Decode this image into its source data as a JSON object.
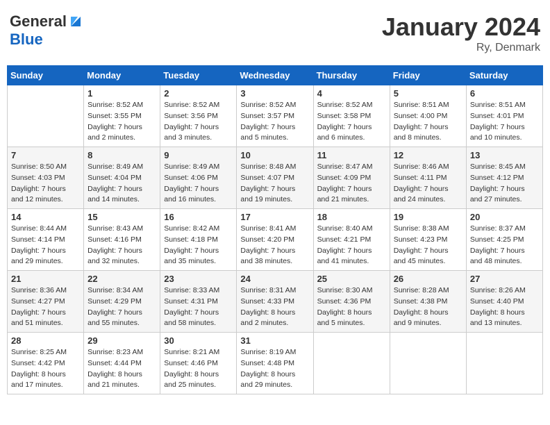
{
  "header": {
    "logo_line1": "General",
    "logo_line2": "Blue",
    "month": "January 2024",
    "location": "Ry, Denmark"
  },
  "days_of_week": [
    "Sunday",
    "Monday",
    "Tuesday",
    "Wednesday",
    "Thursday",
    "Friday",
    "Saturday"
  ],
  "weeks": [
    [
      {
        "day": "",
        "sunrise": "",
        "sunset": "",
        "daylight": ""
      },
      {
        "day": "1",
        "sunrise": "Sunrise: 8:52 AM",
        "sunset": "Sunset: 3:55 PM",
        "daylight": "Daylight: 7 hours and 2 minutes."
      },
      {
        "day": "2",
        "sunrise": "Sunrise: 8:52 AM",
        "sunset": "Sunset: 3:56 PM",
        "daylight": "Daylight: 7 hours and 3 minutes."
      },
      {
        "day": "3",
        "sunrise": "Sunrise: 8:52 AM",
        "sunset": "Sunset: 3:57 PM",
        "daylight": "Daylight: 7 hours and 5 minutes."
      },
      {
        "day": "4",
        "sunrise": "Sunrise: 8:52 AM",
        "sunset": "Sunset: 3:58 PM",
        "daylight": "Daylight: 7 hours and 6 minutes."
      },
      {
        "day": "5",
        "sunrise": "Sunrise: 8:51 AM",
        "sunset": "Sunset: 4:00 PM",
        "daylight": "Daylight: 7 hours and 8 minutes."
      },
      {
        "day": "6",
        "sunrise": "Sunrise: 8:51 AM",
        "sunset": "Sunset: 4:01 PM",
        "daylight": "Daylight: 7 hours and 10 minutes."
      }
    ],
    [
      {
        "day": "7",
        "sunrise": "Sunrise: 8:50 AM",
        "sunset": "Sunset: 4:03 PM",
        "daylight": "Daylight: 7 hours and 12 minutes."
      },
      {
        "day": "8",
        "sunrise": "Sunrise: 8:49 AM",
        "sunset": "Sunset: 4:04 PM",
        "daylight": "Daylight: 7 hours and 14 minutes."
      },
      {
        "day": "9",
        "sunrise": "Sunrise: 8:49 AM",
        "sunset": "Sunset: 4:06 PM",
        "daylight": "Daylight: 7 hours and 16 minutes."
      },
      {
        "day": "10",
        "sunrise": "Sunrise: 8:48 AM",
        "sunset": "Sunset: 4:07 PM",
        "daylight": "Daylight: 7 hours and 19 minutes."
      },
      {
        "day": "11",
        "sunrise": "Sunrise: 8:47 AM",
        "sunset": "Sunset: 4:09 PM",
        "daylight": "Daylight: 7 hours and 21 minutes."
      },
      {
        "day": "12",
        "sunrise": "Sunrise: 8:46 AM",
        "sunset": "Sunset: 4:11 PM",
        "daylight": "Daylight: 7 hours and 24 minutes."
      },
      {
        "day": "13",
        "sunrise": "Sunrise: 8:45 AM",
        "sunset": "Sunset: 4:12 PM",
        "daylight": "Daylight: 7 hours and 27 minutes."
      }
    ],
    [
      {
        "day": "14",
        "sunrise": "Sunrise: 8:44 AM",
        "sunset": "Sunset: 4:14 PM",
        "daylight": "Daylight: 7 hours and 29 minutes."
      },
      {
        "day": "15",
        "sunrise": "Sunrise: 8:43 AM",
        "sunset": "Sunset: 4:16 PM",
        "daylight": "Daylight: 7 hours and 32 minutes."
      },
      {
        "day": "16",
        "sunrise": "Sunrise: 8:42 AM",
        "sunset": "Sunset: 4:18 PM",
        "daylight": "Daylight: 7 hours and 35 minutes."
      },
      {
        "day": "17",
        "sunrise": "Sunrise: 8:41 AM",
        "sunset": "Sunset: 4:20 PM",
        "daylight": "Daylight: 7 hours and 38 minutes."
      },
      {
        "day": "18",
        "sunrise": "Sunrise: 8:40 AM",
        "sunset": "Sunset: 4:21 PM",
        "daylight": "Daylight: 7 hours and 41 minutes."
      },
      {
        "day": "19",
        "sunrise": "Sunrise: 8:38 AM",
        "sunset": "Sunset: 4:23 PM",
        "daylight": "Daylight: 7 hours and 45 minutes."
      },
      {
        "day": "20",
        "sunrise": "Sunrise: 8:37 AM",
        "sunset": "Sunset: 4:25 PM",
        "daylight": "Daylight: 7 hours and 48 minutes."
      }
    ],
    [
      {
        "day": "21",
        "sunrise": "Sunrise: 8:36 AM",
        "sunset": "Sunset: 4:27 PM",
        "daylight": "Daylight: 7 hours and 51 minutes."
      },
      {
        "day": "22",
        "sunrise": "Sunrise: 8:34 AM",
        "sunset": "Sunset: 4:29 PM",
        "daylight": "Daylight: 7 hours and 55 minutes."
      },
      {
        "day": "23",
        "sunrise": "Sunrise: 8:33 AM",
        "sunset": "Sunset: 4:31 PM",
        "daylight": "Daylight: 7 hours and 58 minutes."
      },
      {
        "day": "24",
        "sunrise": "Sunrise: 8:31 AM",
        "sunset": "Sunset: 4:33 PM",
        "daylight": "Daylight: 8 hours and 2 minutes."
      },
      {
        "day": "25",
        "sunrise": "Sunrise: 8:30 AM",
        "sunset": "Sunset: 4:36 PM",
        "daylight": "Daylight: 8 hours and 5 minutes."
      },
      {
        "day": "26",
        "sunrise": "Sunrise: 8:28 AM",
        "sunset": "Sunset: 4:38 PM",
        "daylight": "Daylight: 8 hours and 9 minutes."
      },
      {
        "day": "27",
        "sunrise": "Sunrise: 8:26 AM",
        "sunset": "Sunset: 4:40 PM",
        "daylight": "Daylight: 8 hours and 13 minutes."
      }
    ],
    [
      {
        "day": "28",
        "sunrise": "Sunrise: 8:25 AM",
        "sunset": "Sunset: 4:42 PM",
        "daylight": "Daylight: 8 hours and 17 minutes."
      },
      {
        "day": "29",
        "sunrise": "Sunrise: 8:23 AM",
        "sunset": "Sunset: 4:44 PM",
        "daylight": "Daylight: 8 hours and 21 minutes."
      },
      {
        "day": "30",
        "sunrise": "Sunrise: 8:21 AM",
        "sunset": "Sunset: 4:46 PM",
        "daylight": "Daylight: 8 hours and 25 minutes."
      },
      {
        "day": "31",
        "sunrise": "Sunrise: 8:19 AM",
        "sunset": "Sunset: 4:48 PM",
        "daylight": "Daylight: 8 hours and 29 minutes."
      },
      {
        "day": "",
        "sunrise": "",
        "sunset": "",
        "daylight": ""
      },
      {
        "day": "",
        "sunrise": "",
        "sunset": "",
        "daylight": ""
      },
      {
        "day": "",
        "sunrise": "",
        "sunset": "",
        "daylight": ""
      }
    ]
  ]
}
